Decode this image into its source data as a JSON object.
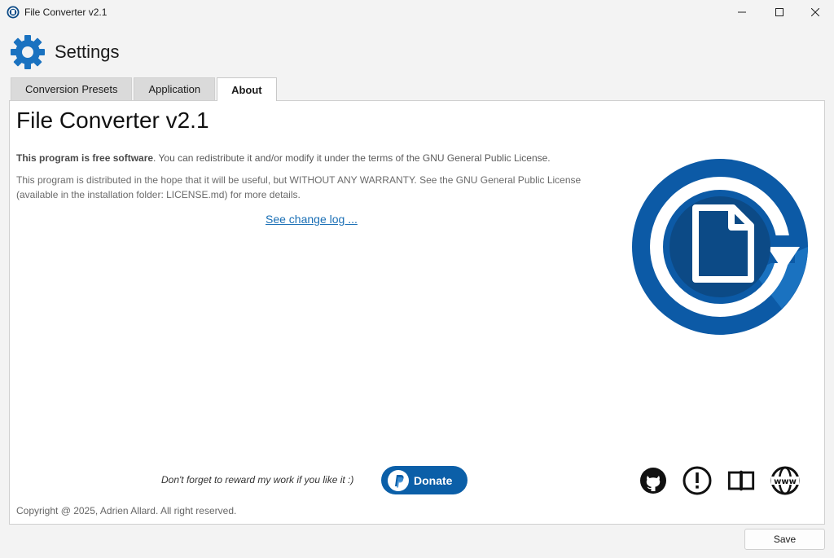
{
  "window": {
    "title": "File Converter v2.1"
  },
  "header": {
    "title": "Settings"
  },
  "tabs": [
    {
      "label": "Conversion Presets"
    },
    {
      "label": "Application"
    },
    {
      "label": "About"
    }
  ],
  "about": {
    "title": "File Converter v2.1",
    "free_bold": "This program is free software",
    "free_rest": ". You can redistribute it and/or modify it under the terms of the GNU General Public License.",
    "warranty": "This program is distributed in the hope that it will be useful, but WITHOUT ANY WARRANTY. See the GNU General Public License (available in the installation folder: LICENSE.md) for more details.",
    "changelog_link": "See change log ...",
    "reward_text": "Don't forget to reward my work if you like it :)",
    "donate_label": "Donate",
    "copyright": "Copyright @ 2025, Adrien Allard. All right reserved."
  },
  "links": [
    {
      "icon": "github-icon"
    },
    {
      "icon": "report-issue-icon"
    },
    {
      "icon": "documentation-book-icon"
    },
    {
      "icon": "website-www-icon"
    }
  ],
  "footer": {
    "save_label": "Save"
  },
  "colors": {
    "accent": "#0b5fa8",
    "link": "#1a6fb5",
    "logo_dark": "#0c4a86",
    "logo_light": "#1a72c0"
  }
}
